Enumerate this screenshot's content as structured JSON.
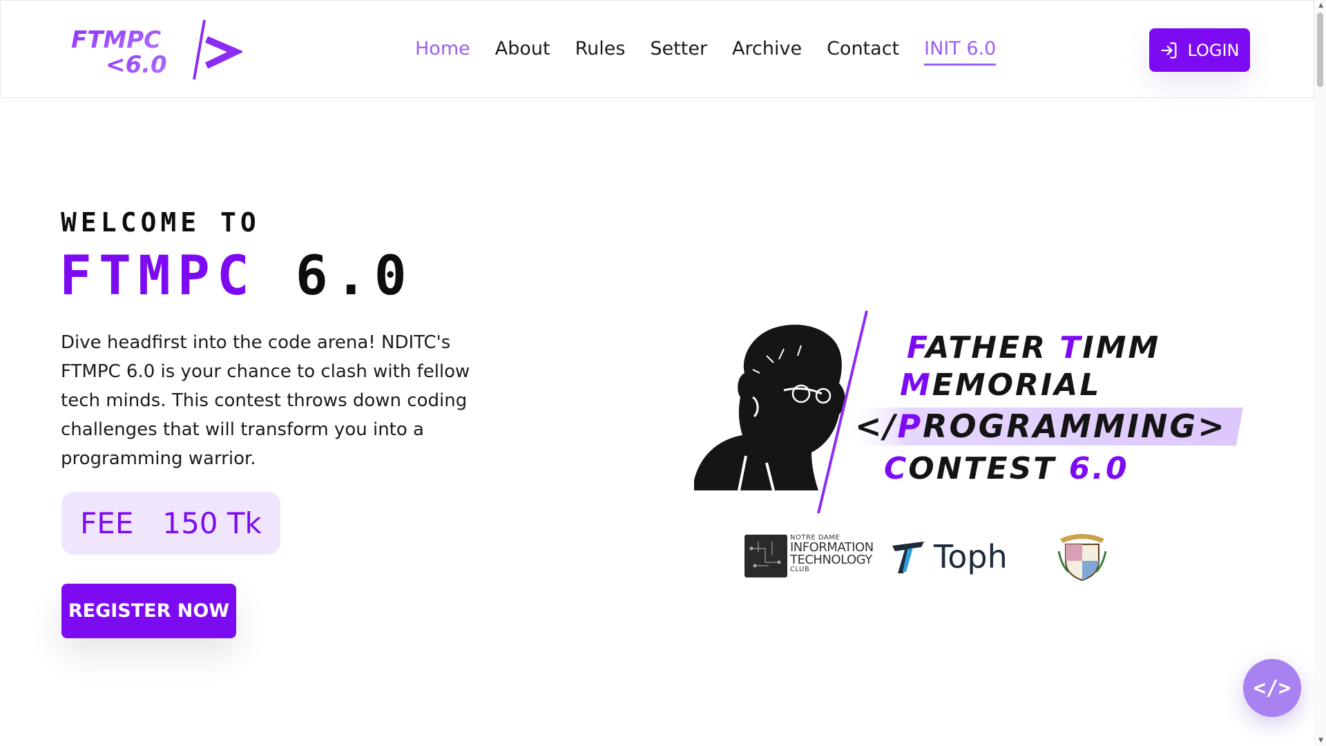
{
  "header": {
    "logo_text": "FTMPC <6.0",
    "nav": [
      {
        "label": "Home"
      },
      {
        "label": "About"
      },
      {
        "label": "Rules"
      },
      {
        "label": "Setter"
      },
      {
        "label": "Archive"
      },
      {
        "label": "Contact"
      },
      {
        "label": "INIT 6.0"
      }
    ],
    "login_label": "LOGIN"
  },
  "hero": {
    "welcome": "WELCOME TO",
    "title_brand": "FTMPC",
    "title_version": "6.0",
    "description": "Dive headfirst into the code arena! NDITC's FTMPC 6.0 is your chance to clash with fellow tech minds. This contest throws down coding challenges that will transform you into a programming warrior.",
    "fee_label": "FEE",
    "fee_value": "150 Tk",
    "register_label": "REGISTER NOW"
  },
  "banner": {
    "line1_hl1": "F",
    "line1_a": "ATHER ",
    "line1_hl2": "T",
    "line1_b": "IMM",
    "line2_hl": "M",
    "line2": "EMORIAL",
    "line3_pre": "</",
    "line3_hl": "P",
    "line3": "ROGRAMMING>",
    "line4_hl": "C",
    "line4": "ONTEST ",
    "line4_ver": "6.0"
  },
  "sponsors": {
    "nditc_l1": "NOTRE DAME",
    "nditc_l2": "INFORMATION",
    "nditc_l3": "TECHNOLOGY",
    "nditc_l4": "CLUB",
    "toph": "Toph"
  },
  "fab": {
    "label": "</>"
  },
  "colors": {
    "accent": "#7c0bf2",
    "accent_light": "#9b5df5",
    "fee_bg": "#efe5fd",
    "fab": "#a782f0"
  }
}
